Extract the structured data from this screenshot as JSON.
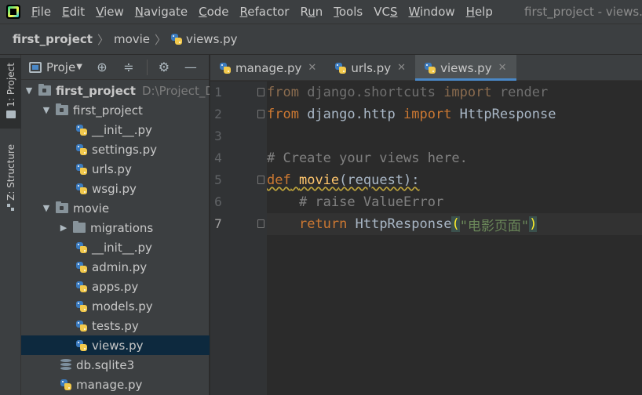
{
  "menubar": {
    "items": [
      "File",
      "Edit",
      "View",
      "Navigate",
      "Code",
      "Refactor",
      "Run",
      "Tools",
      "VCS",
      "Window",
      "Help"
    ],
    "underline": [
      "F",
      "E",
      "V",
      "N",
      "C",
      "R",
      "u",
      "T",
      "S",
      "W",
      "H"
    ],
    "window_title": "first_project - views.py"
  },
  "breadcrumb": {
    "project": "first_project",
    "folder": "movie",
    "file": "views.py"
  },
  "toolstrip": {
    "project_tab": "1: Project",
    "structure_tab": "Z: Structure"
  },
  "project_panel": {
    "title": "Proje",
    "tree": {
      "root": "first_project",
      "root_path": "D:\\Project_Dj",
      "first_project_folder": "first_project",
      "init_file": "__init__.py",
      "settings_file": "settings.py",
      "urls_file": "urls.py",
      "wsgi_file": "wsgi.py",
      "movie_folder": "movie",
      "migrations_folder": "migrations",
      "movie_init_file": "__init__.py",
      "admin_file": "admin.py",
      "apps_file": "apps.py",
      "models_file": "models.py",
      "tests_file": "tests.py",
      "views_file": "views.py",
      "db_file": "db.sqlite3",
      "manage_file": "manage.py"
    }
  },
  "editor": {
    "tabs": [
      {
        "label": "manage.py"
      },
      {
        "label": "urls.py"
      },
      {
        "label": "views.py"
      }
    ],
    "line_numbers": [
      "1",
      "2",
      "3",
      "4",
      "5",
      "6",
      "7"
    ],
    "code": {
      "l1_from": "from",
      "l1_module": " django.shortcuts ",
      "l1_import": "import",
      "l1_name": " render",
      "l2_from": "from",
      "l2_module": " django.http ",
      "l2_import": "import",
      "l2_name": " HttpResponse",
      "l4_comment": "# Create your views here.",
      "l5_def": "def",
      "l5_fn": "movie",
      "l5_args": "(request):",
      "l6_comment": "# raise ValueError",
      "l7_return": "return",
      "l7_call": " HttpResponse",
      "l7_open": "(",
      "l7_string": "\"电影页面\"",
      "l7_close": ")"
    }
  }
}
